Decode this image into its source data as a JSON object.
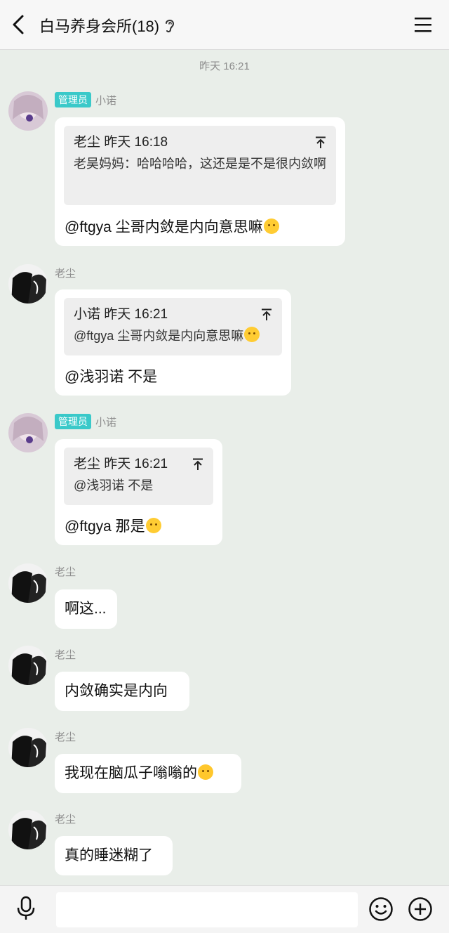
{
  "header": {
    "title": "白马养身会所(18)"
  },
  "timestamp": "昨天 16:21",
  "messages": [
    {
      "sender": "小诺",
      "badge": "管理员",
      "quote_head": "老尘 昨天 16:18",
      "quote_text": "老吴妈妈：哈哈哈哈，这还是是不是很内敛啊",
      "text": "@ftgya 尘哥内敛是内向意思嘛"
    },
    {
      "sender": "老尘",
      "quote_head": "小诺 昨天 16:21",
      "quote_text": "@ftgya 尘哥内敛是内向意思嘛",
      "text": "@浅羽诺 不是"
    },
    {
      "sender": "小诺",
      "badge": "管理员",
      "quote_head": "老尘 昨天 16:21",
      "quote_text": "@浅羽诺 不是",
      "text": "@ftgya 那是"
    },
    {
      "sender": "老尘",
      "text": "啊这..."
    },
    {
      "sender": "老尘",
      "text": "内敛确实是内向"
    },
    {
      "sender": "老尘",
      "text": "我现在脑瓜子嗡嗡的"
    },
    {
      "sender": "老尘",
      "text": "真的睡迷糊了"
    }
  ],
  "icons": {
    "back": "back-arrow-icon",
    "ear": "ear-icon",
    "menu": "menu-icon",
    "pin": "pin-to-top-icon",
    "mic": "microphone-icon",
    "emoji": "emoji-icon",
    "plus": "plus-icon"
  },
  "colors": {
    "background": "#e9eee9",
    "badge": "#3ac9c9",
    "bubble": "#ffffff",
    "quote": "#eeeeee"
  }
}
